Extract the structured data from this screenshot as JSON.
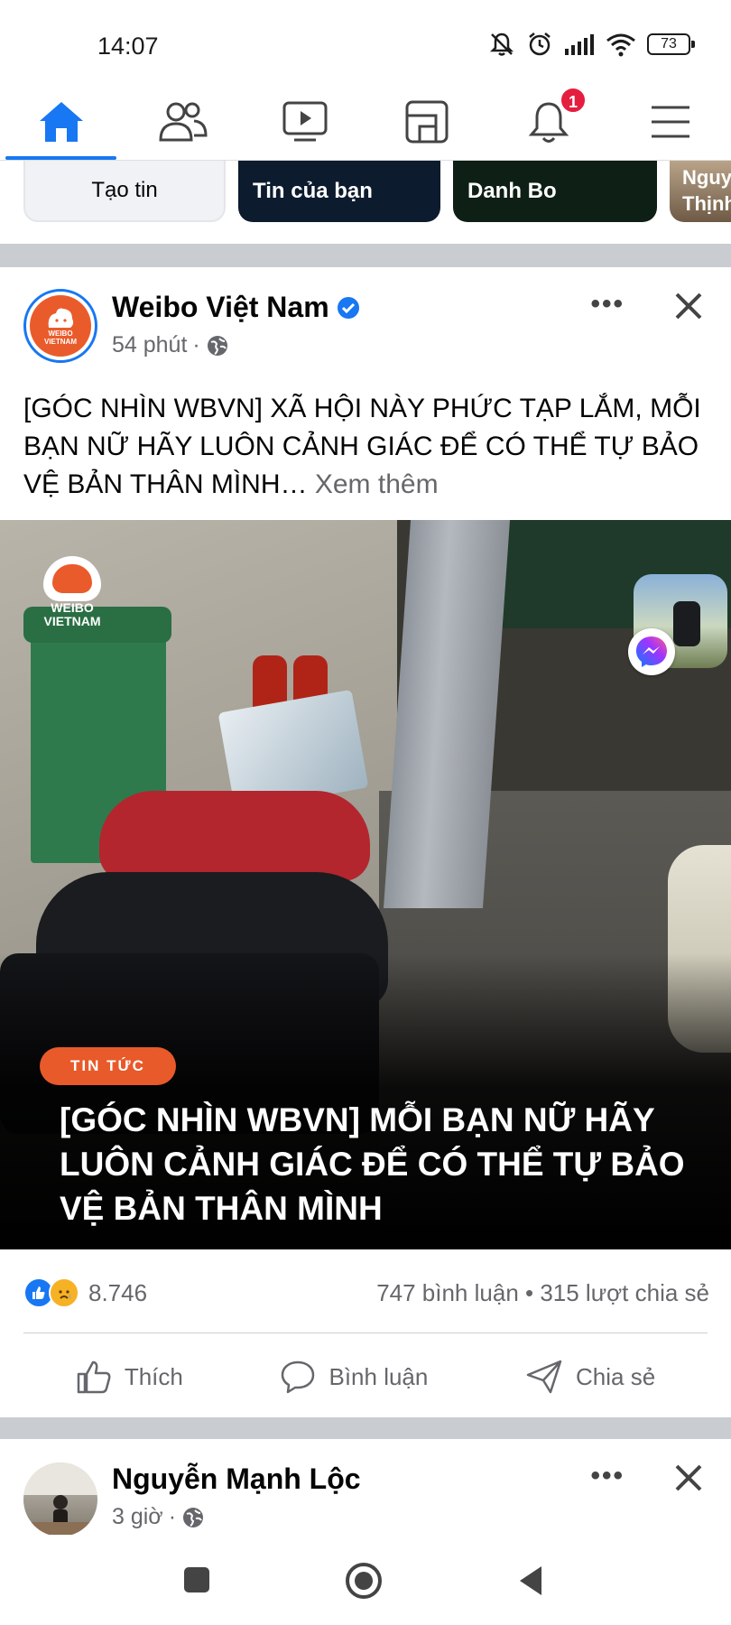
{
  "status_bar": {
    "time": "14:07",
    "battery": "73"
  },
  "top_nav": {
    "tabs": [
      "home-icon",
      "friends-icon",
      "watch-icon",
      "marketplace-icon",
      "notifications-icon",
      "menu-icon"
    ],
    "notification_badge": "1",
    "accent": "#1877f2"
  },
  "stories": {
    "create": "Tạo tin",
    "yours": "Tin của bạn",
    "danh_bo": "Danh Bo",
    "partial_line1": "Nguy",
    "partial_line2": "Thịnh"
  },
  "post": {
    "page_name": "Weibo Việt Nam",
    "avatar_line1": "WEIBO",
    "avatar_line2": "VIETNAM",
    "time": "54 phút",
    "dot": "·",
    "text": "[GÓC NHÌN WBVN] XÃ HỘI NÀY PHỨC TẠP LẮM, MỖI BẠN NỮ HÃY LUÔN CẢNH GIÁC ĐỂ CÓ THỂ TỰ BẢO VỆ BẢN THÂN MÌNH…",
    "see_more": "Xem thêm",
    "media": {
      "watermark_line1": "WEIBO",
      "watermark_line2": "VIETNAM",
      "tag": "TIN TỨC",
      "headline": "[GÓC NHÌN WBVN] MỖI BẠN NỮ HÃY LUÔN CẢNH GIÁC ĐỂ CÓ THỂ TỰ BẢO VỆ BẢN THÂN MÌNH"
    },
    "reaction_count": "8.746",
    "comments_shares": "747 bình luận • 315 lượt chia sẻ",
    "actions": {
      "like": "Thích",
      "comment": "Bình luận",
      "share": "Chia sẻ"
    }
  },
  "next_post": {
    "name": "Nguyễn Mạnh Lộc",
    "time": "3 giờ",
    "dot": "·"
  },
  "system_nav": [
    "recents-icon",
    "home-circle-icon",
    "back-icon"
  ]
}
